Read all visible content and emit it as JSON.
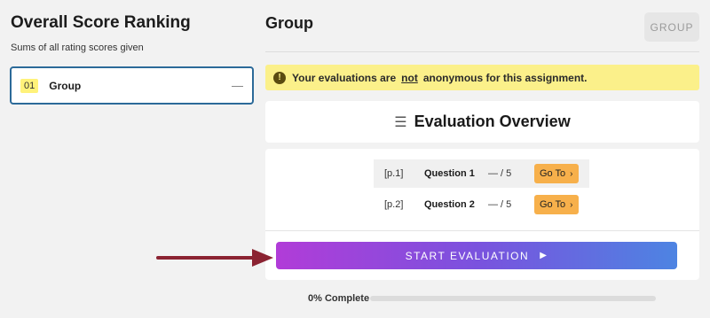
{
  "left": {
    "title": "Overall Score Ranking",
    "subtitle": "Sums of all rating scores given",
    "ranking": [
      {
        "rank": "01",
        "name": "Group",
        "score": "—"
      }
    ]
  },
  "right": {
    "title": "Group",
    "group_button": "GROUP",
    "notice": {
      "pre": "Your evaluations are",
      "emph": "not",
      "post": "anonymous for this assignment.",
      "icon": "!"
    },
    "overview_title": "Evaluation Overview",
    "questions": [
      {
        "page": "[p.1]",
        "name": "Question 1",
        "score": "— / 5",
        "goto": "Go To"
      },
      {
        "page": "[p.2]",
        "name": "Question 2",
        "score": "— / 5",
        "goto": "Go To"
      }
    ],
    "start_button": "START EVALUATION",
    "progress": {
      "label": "0% Complete",
      "value": 0
    }
  },
  "colors": {
    "accent_border": "#2c6a99",
    "notice_bg": "#fbf08a",
    "goto_bg": "#f7b04b",
    "gradient_start": "#b13cd8",
    "gradient_end": "#4d84e2",
    "arrow": "#8b2332"
  }
}
